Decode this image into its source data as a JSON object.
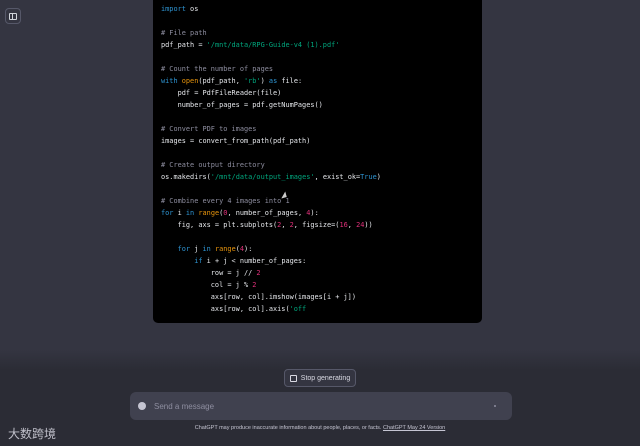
{
  "code_lines": [
    [
      [
        "import",
        "kw"
      ],
      [
        " os",
        "pl"
      ]
    ],
    [],
    [
      [
        "# File path",
        "cm"
      ]
    ],
    [
      [
        "pdf_path = ",
        "pl"
      ],
      [
        "'/mnt/data/RPG-Guide-v4 (1).pdf'",
        "st"
      ]
    ],
    [],
    [
      [
        "# Count the number of pages",
        "cm"
      ]
    ],
    [
      [
        "with ",
        "kw"
      ],
      [
        "open",
        "bi"
      ],
      [
        "(pdf_path, ",
        "pl"
      ],
      [
        "'rb'",
        "st"
      ],
      [
        ") ",
        "pl"
      ],
      [
        "as",
        "kw"
      ],
      [
        " file:",
        "pl"
      ]
    ],
    [
      [
        "    pdf = PdfFileReader(file)",
        "pl"
      ]
    ],
    [
      [
        "    number_of_pages = pdf.getNumPages()",
        "pl"
      ]
    ],
    [],
    [
      [
        "# Convert PDF to images",
        "cm"
      ]
    ],
    [
      [
        "images = convert_from_path(pdf_path)",
        "pl"
      ]
    ],
    [],
    [
      [
        "# Create output directory",
        "cm"
      ]
    ],
    [
      [
        "os.makedirs(",
        "pl"
      ],
      [
        "'/mnt/data/output_images'",
        "st"
      ],
      [
        ", exist_ok=",
        "pl"
      ],
      [
        "True",
        "kw"
      ],
      [
        ")",
        "pl"
      ]
    ],
    [],
    [
      [
        "# Combine every 4 images into 1",
        "cm"
      ]
    ],
    [
      [
        "for",
        "kw"
      ],
      [
        " i ",
        "pl"
      ],
      [
        "in",
        "kw"
      ],
      [
        " ",
        "pl"
      ],
      [
        "range",
        "bi"
      ],
      [
        "(",
        "pl"
      ],
      [
        "0",
        "nm"
      ],
      [
        ", number_of_pages, ",
        "pl"
      ],
      [
        "4",
        "nm"
      ],
      [
        "):",
        "pl"
      ]
    ],
    [
      [
        "    fig, axs = plt.subplots(",
        "pl"
      ],
      [
        "2",
        "nm"
      ],
      [
        ", ",
        "pl"
      ],
      [
        "2",
        "nm"
      ],
      [
        ", figsize=(",
        "pl"
      ],
      [
        "16",
        "nm"
      ],
      [
        ", ",
        "pl"
      ],
      [
        "24",
        "nm"
      ],
      [
        "))",
        "pl"
      ]
    ],
    [],
    [
      [
        "    ",
        "pl"
      ],
      [
        "for",
        "kw"
      ],
      [
        " j ",
        "pl"
      ],
      [
        "in",
        "kw"
      ],
      [
        " ",
        "pl"
      ],
      [
        "range",
        "bi"
      ],
      [
        "(",
        "pl"
      ],
      [
        "4",
        "nm"
      ],
      [
        "):",
        "pl"
      ]
    ],
    [
      [
        "        ",
        "pl"
      ],
      [
        "if",
        "kw"
      ],
      [
        " i + j < number_of_pages:",
        "pl"
      ]
    ],
    [
      [
        "            row = j // ",
        "pl"
      ],
      [
        "2",
        "nm"
      ]
    ],
    [
      [
        "            col = j % ",
        "pl"
      ],
      [
        "2",
        "nm"
      ]
    ],
    [
      [
        "            axs[row, col].imshow(images[i + j])",
        "pl"
      ]
    ],
    [
      [
        "            axs[row, col].axis(",
        "pl"
      ],
      [
        "'off",
        "st"
      ]
    ]
  ],
  "stop_button": {
    "label": "Stop generating"
  },
  "composer": {
    "placeholder": "Send a message"
  },
  "footer": {
    "text": "ChatGPT may produce inaccurate information about people, places, or facts. ",
    "link": "ChatGPT May 24 Version"
  },
  "watermark": "大数跨境"
}
